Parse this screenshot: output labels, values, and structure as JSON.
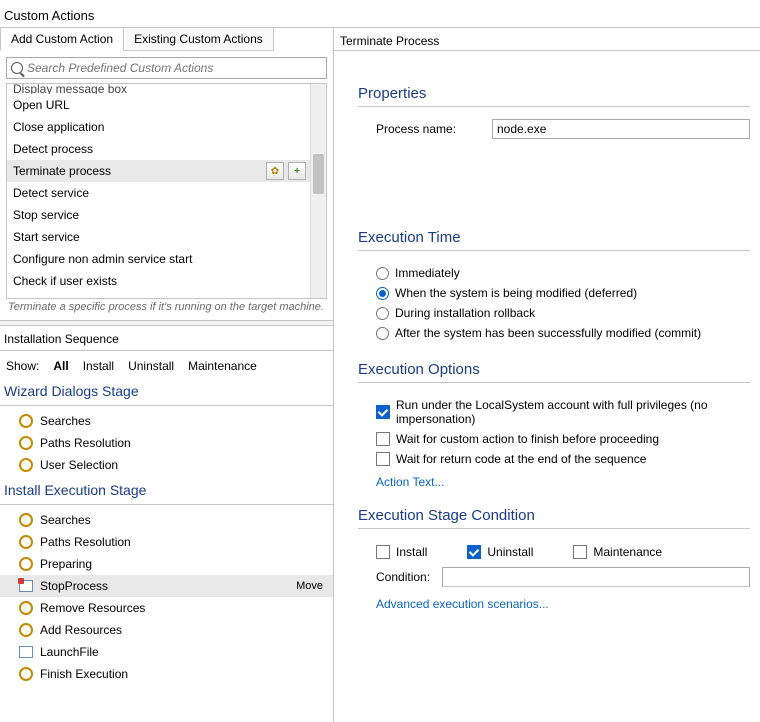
{
  "title": "Custom Actions",
  "tabs": {
    "add": "Add Custom Action",
    "existing": "Existing Custom Actions"
  },
  "search": {
    "placeholder": "Search Predefined Custom Actions"
  },
  "actions": {
    "cutoff_top": "Display message box",
    "items": [
      "Open URL",
      "Close application",
      "Detect process",
      "Terminate process",
      "Detect service",
      "Stop service",
      "Start service",
      "Configure non admin service start",
      "Check if user exists"
    ],
    "selected_index": 3
  },
  "hint": "Terminate a specific process if it's running on the target machine.",
  "seq_title": "Installation Sequence",
  "show": {
    "label": "Show:",
    "all": "All",
    "install": "Install",
    "uninstall": "Uninstall",
    "maintenance": "Maintenance"
  },
  "stages": {
    "wizard": {
      "title": "Wizard Dialogs Stage",
      "items": [
        "Searches",
        "Paths Resolution",
        "User Selection"
      ]
    },
    "install": {
      "title": "Install Execution Stage",
      "items": [
        "Searches",
        "Paths Resolution",
        "Preparing",
        "StopProcess",
        "Remove Resources",
        "Add Resources",
        "LaunchFile",
        "Finish Execution"
      ],
      "selected_index": 3,
      "selected_action": "Move"
    }
  },
  "right": {
    "title": "Terminate Process",
    "properties": {
      "heading": "Properties",
      "process_name_label": "Process name:",
      "process_name_value": "node.exe"
    },
    "exec_time": {
      "heading": "Execution Time",
      "options": [
        "Immediately",
        "When the system is being modified (deferred)",
        "During installation rollback",
        "After the system has been successfully modified (commit)"
      ],
      "selected_index": 1
    },
    "exec_options": {
      "heading": "Execution Options",
      "items": [
        {
          "label": "Run under the LocalSystem account with full privileges (no impersonation)",
          "checked": true
        },
        {
          "label": "Wait for custom action to finish before proceeding",
          "checked": false
        },
        {
          "label": "Wait for return code at the end of the sequence",
          "checked": false
        }
      ],
      "action_text_link": "Action Text..."
    },
    "stage_cond": {
      "heading": "Execution Stage Condition",
      "install": {
        "label": "Install",
        "checked": false
      },
      "uninstall": {
        "label": "Uninstall",
        "checked": true
      },
      "maintenance": {
        "label": "Maintenance",
        "checked": false
      },
      "condition_label": "Condition:",
      "condition_value": "",
      "advanced_link": "Advanced execution scenarios..."
    }
  }
}
